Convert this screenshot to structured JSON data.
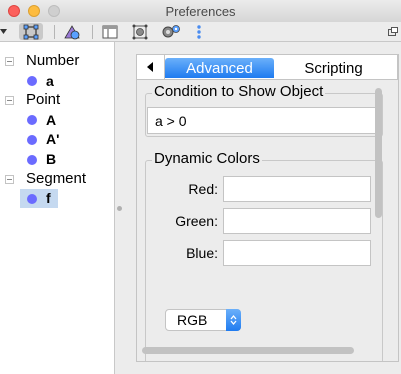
{
  "window": {
    "title": "Preferences"
  },
  "toolbar": {
    "icons": [
      "dropdown-arrow-icon",
      "object-properties-icon",
      "graphics-icon",
      "layout-icon",
      "defaults-icon",
      "advanced-settings-icon",
      "more-options-icon",
      "window-options-icon"
    ]
  },
  "tree": {
    "categories": [
      {
        "label": "Number",
        "objects": [
          "a"
        ]
      },
      {
        "label": "Point",
        "objects": [
          "A",
          "A'",
          "B"
        ]
      },
      {
        "label": "Segment",
        "objects": [
          "f"
        ]
      }
    ],
    "selected_object": "f",
    "object_color": "#6b6bff"
  },
  "tabs": {
    "active": "Advanced",
    "inactive": "Scripting"
  },
  "condition": {
    "title": "Condition to Show Object",
    "value": "a > 0"
  },
  "dynamic_colors": {
    "title": "Dynamic Colors",
    "red_label": "Red:",
    "green_label": "Green:",
    "blue_label": "Blue:",
    "red_value": "",
    "green_value": "",
    "blue_value": "",
    "color_space": "RGB"
  },
  "colors": {
    "accent": "#1f7bf0",
    "selection": "#c5d9f0"
  }
}
